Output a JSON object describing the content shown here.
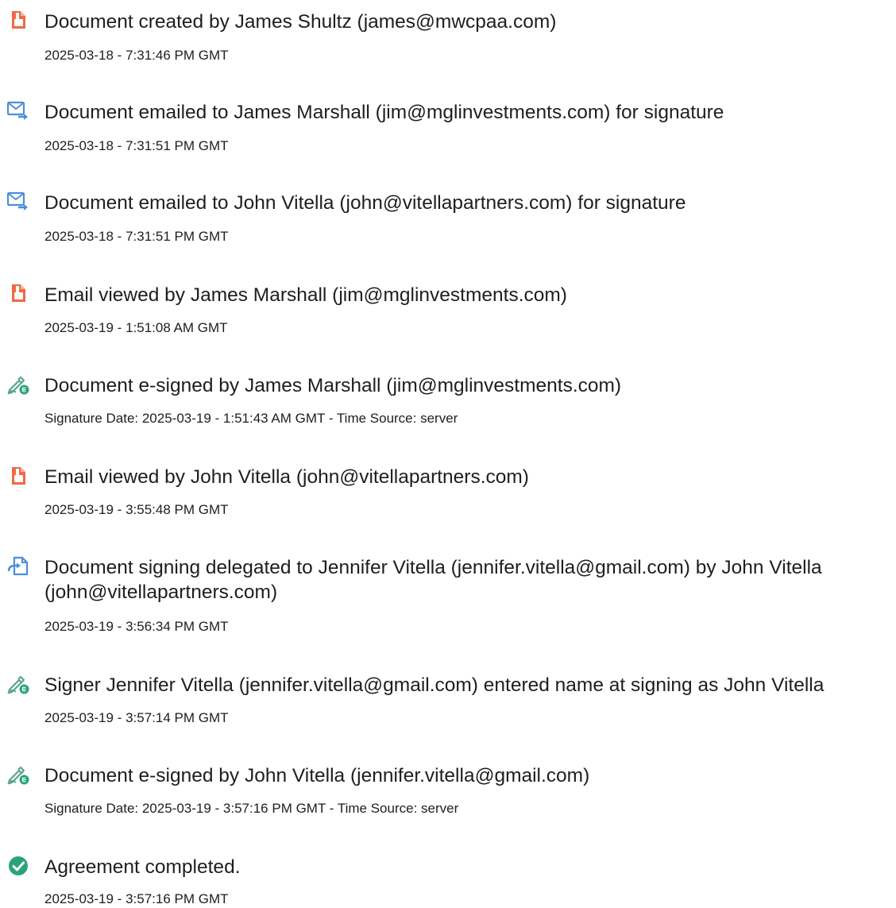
{
  "events": [
    {
      "icon": "document-created-icon",
      "title": "Document created by James Shultz (james@mwcpaa.com)",
      "sub": "2025-03-18 - 7:31:46 PM GMT"
    },
    {
      "icon": "email-sent-icon",
      "title": "Document emailed to James Marshall (jim@mglinvestments.com) for signature",
      "sub": "2025-03-18 - 7:31:51 PM GMT"
    },
    {
      "icon": "email-sent-icon",
      "title": "Document emailed to John Vitella (john@vitellapartners.com) for signature",
      "sub": "2025-03-18 - 7:31:51 PM GMT"
    },
    {
      "icon": "document-viewed-icon",
      "title": "Email viewed by James Marshall (jim@mglinvestments.com)",
      "sub": "2025-03-19 - 1:51:08 AM GMT"
    },
    {
      "icon": "esign-pen-icon",
      "title": "Document e-signed by James Marshall (jim@mglinvestments.com)",
      "sub": "Signature Date: 2025-03-19 - 1:51:43 AM GMT - Time Source: server"
    },
    {
      "icon": "document-viewed-icon",
      "title": "Email viewed by John Vitella (john@vitellapartners.com)",
      "sub": "2025-03-19 - 3:55:48 PM GMT"
    },
    {
      "icon": "delegate-icon",
      "title": "Document signing delegated to Jennifer Vitella (jennifer.vitella@gmail.com) by John Vitella (john@vitellapartners.com)",
      "sub": "2025-03-19 - 3:56:34 PM GMT"
    },
    {
      "icon": "esign-pen-icon",
      "title": "Signer Jennifer Vitella (jennifer.vitella@gmail.com) entered name at signing as John Vitella",
      "sub": "2025-03-19 - 3:57:14 PM GMT"
    },
    {
      "icon": "esign-pen-icon",
      "title": "Document e-signed by John Vitella (jennifer.vitella@gmail.com)",
      "sub": "Signature Date: 2025-03-19 - 3:57:16 PM GMT - Time Source: server"
    },
    {
      "icon": "check-circle-icon",
      "title": "Agreement completed.",
      "sub": "2025-03-19 - 3:57:16 PM GMT"
    }
  ],
  "colors": {
    "doc_orange": "#ef6a43",
    "mail_blue": "#4a8fd9",
    "sign_green": "#5aa58c",
    "check_green": "#2aa37d"
  }
}
